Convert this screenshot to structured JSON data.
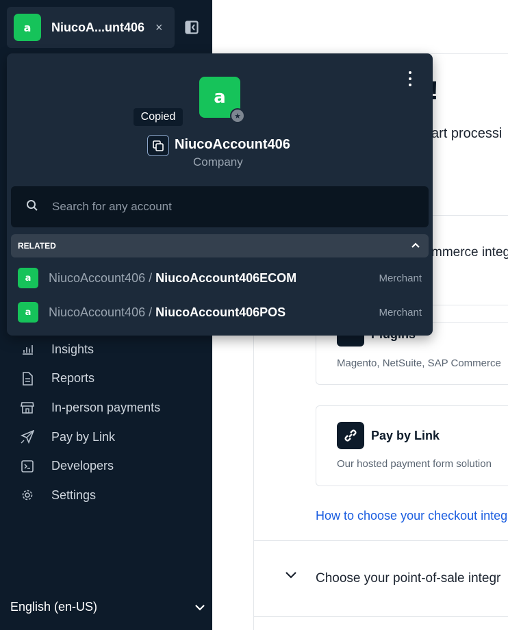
{
  "sidebar": {
    "account_chip": {
      "name": "NiucoA...unt406",
      "close": "×"
    },
    "nav": [
      {
        "label": "Insights",
        "icon": "bar-chart-icon"
      },
      {
        "label": "Reports",
        "icon": "document-icon"
      },
      {
        "label": "In-person payments",
        "icon": "store-icon"
      },
      {
        "label": "Pay by Link",
        "icon": "paper-plane-icon"
      },
      {
        "label": "Developers",
        "icon": "terminal-icon"
      },
      {
        "label": "Settings",
        "icon": "gear-icon"
      }
    ],
    "language": "English (en-US)"
  },
  "popover": {
    "logo_letter": "a",
    "tooltip": "Copied",
    "account_name": "NiucoAccount406",
    "account_type": "Company",
    "search_placeholder": "Search for any account",
    "related_label": "RELATED",
    "related": [
      {
        "parent": "NiucoAccount406",
        "sep": " / ",
        "child": "NiucoAccount406ECOM",
        "role": "Merchant"
      },
      {
        "parent": "NiucoAccount406",
        "sep": " / ",
        "child": "NiucoAccount406POS",
        "role": "Merchant"
      }
    ]
  },
  "main": {
    "heading_fragment": "!",
    "intro_fragment": "art processi",
    "ecommerce_fragment": "mmerce integra",
    "plugins_title": "Plugins",
    "plugins_desc": "Magento, NetSuite, SAP Commerce",
    "pay_by_link_title": "Pay by Link",
    "pay_by_link_desc": "Our hosted payment form solution",
    "checkout_link": "How to choose your checkout integ",
    "pos_fragment": "Choose your point-of-sale integr"
  },
  "colors": {
    "brand_green": "#16c35a",
    "sidebar_bg": "#0d1b2a",
    "popover_bg": "#1c2a3a",
    "link_blue": "#1a5de0"
  }
}
